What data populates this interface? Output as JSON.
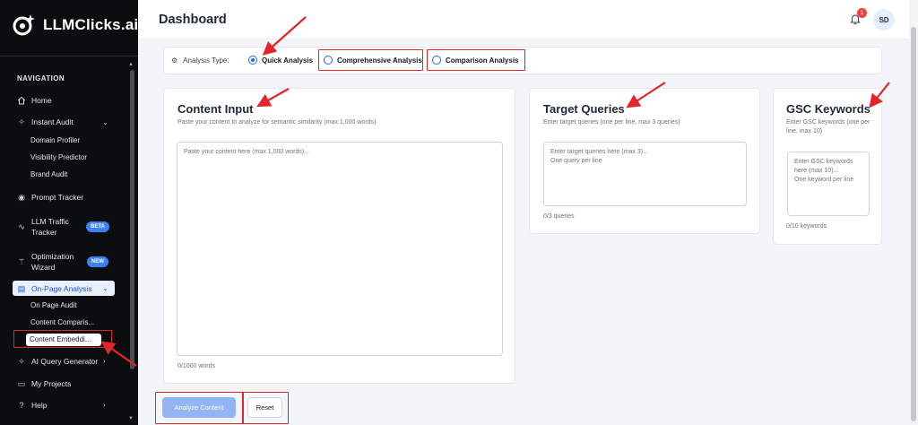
{
  "app": {
    "name": "LLMClicks.ai"
  },
  "sidebar": {
    "section_label": "NAVIGATION",
    "items": [
      {
        "label": "Home",
        "icon": "home-icon"
      },
      {
        "label": "Instant Audit",
        "icon": "sparkle-icon",
        "children": [
          "Domain Profiler",
          "Visibility Predictor",
          "Brand Audit"
        ]
      },
      {
        "label": "Prompt Tracker",
        "icon": "eye-icon"
      },
      {
        "label_line1": "LLM Traffic",
        "label_line2": "Tracker",
        "badge": "BETA",
        "icon": "activity-icon"
      },
      {
        "label_line1": "Optimization",
        "label_line2": "Wizard",
        "badge": "NEW",
        "icon": "wand-icon"
      },
      {
        "label": "On-Page Analysis",
        "icon": "document-icon",
        "children": [
          "On Page Audit",
          "Content Comparis...",
          "Content Embeddi..."
        ]
      },
      {
        "label": "AI Query Generator",
        "icon": "sparkle-icon"
      },
      {
        "label": "My Projects",
        "icon": "folder-icon"
      },
      {
        "label": "Help",
        "icon": "help-icon"
      }
    ]
  },
  "header": {
    "title": "Dashboard",
    "notification_count": "1",
    "avatar_initials": "SD"
  },
  "analysis_type": {
    "label": "Analysis Type:",
    "options": [
      "Quick Analysis",
      "Comprehensive Analysis",
      "Comparison Analysis"
    ],
    "selected": "Quick Analysis"
  },
  "content_input": {
    "title": "Content Input",
    "subtitle": "Paste your content to analyze for semantic similarity (max 1,000 words)",
    "placeholder": "Paste your content here (max 1,000 words)...",
    "counter": "0/1000 words"
  },
  "target_queries": {
    "title": "Target Queries",
    "subtitle": "Enter target queries (one per line, max 3 queries)",
    "placeholder": "Enter target queries here (max 3)...\nOne query per line",
    "counter": "0/3 queries"
  },
  "gsc_keywords": {
    "title": "GSC Keywords",
    "subtitle": "Enter GSC keywords (one per line, max 10)",
    "placeholder": "Enter GSC keywords here (max 10)...\nOne keyword per line",
    "counter": "0/10 keywords"
  },
  "actions": {
    "analyze_label": "Analyze Content",
    "reset_label": "Reset"
  },
  "colors": {
    "sidebar_bg": "#0c0d0f",
    "accent": "#2563eb",
    "annotation": "#e3242b",
    "analyze_disabled": "#93b4f5"
  }
}
